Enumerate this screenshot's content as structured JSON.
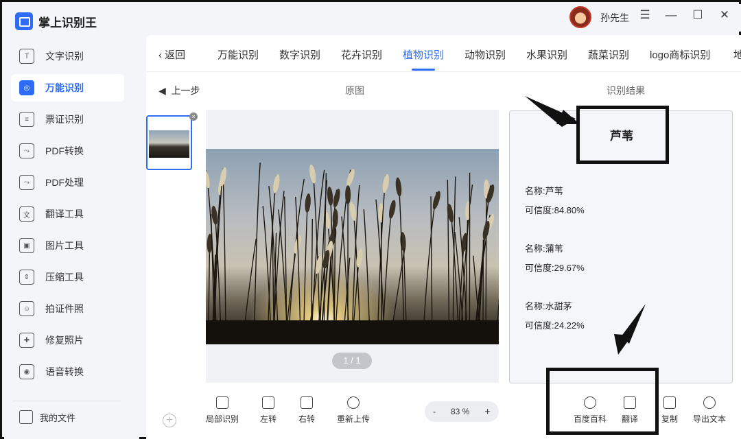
{
  "app": {
    "name": "掌上识别王"
  },
  "user": {
    "name": "孙先生"
  },
  "window_controls": [
    "☰",
    "—",
    "☐",
    "✕"
  ],
  "sidebar": {
    "items": [
      {
        "label": "文字识别",
        "icon": "text-recognition-icon",
        "glyph": "T"
      },
      {
        "label": "万能识别",
        "icon": "universal-recognition-icon",
        "glyph": "◎",
        "active": true
      },
      {
        "label": "票证识别",
        "icon": "ticket-icon",
        "glyph": "≡"
      },
      {
        "label": "PDF转换",
        "icon": "pdf-convert-icon",
        "glyph": "⤳"
      },
      {
        "label": "PDF处理",
        "icon": "pdf-process-icon",
        "glyph": "⤳"
      },
      {
        "label": "翻译工具",
        "icon": "translate-icon",
        "glyph": "文"
      },
      {
        "label": "图片工具",
        "icon": "image-icon",
        "glyph": "▣"
      },
      {
        "label": "压缩工具",
        "icon": "compress-icon",
        "glyph": "⇕"
      },
      {
        "label": "拍证件照",
        "icon": "id-photo-icon",
        "glyph": "☺"
      },
      {
        "label": "修复照片",
        "icon": "repair-photo-icon",
        "glyph": "✚"
      },
      {
        "label": "语音转换",
        "icon": "voice-icon",
        "glyph": "◉"
      }
    ],
    "my_files": "我的文件"
  },
  "tabs": {
    "back": "返回",
    "items": [
      "万能识别",
      "数字识别",
      "花卉识别",
      "植物识别",
      "动物识别",
      "水果识别",
      "蔬菜识别",
      "logo商标识别",
      "地"
    ],
    "active_index": 3
  },
  "panel": {
    "prev_step": "上一步",
    "original_title": "原图",
    "result_title": "识别结果",
    "page_indicator": "1 / 1"
  },
  "result": {
    "headline": "芦苇",
    "candidates": [
      {
        "name": "名称:芦苇",
        "confidence": "可信度:84.80%"
      },
      {
        "name": "名称:蒲苇",
        "confidence": "可信度:29.67%"
      },
      {
        "name": "名称:水甜茅",
        "confidence": "可信度:24.22%"
      }
    ]
  },
  "toolbar": {
    "left": [
      "局部识别",
      "左转",
      "右转",
      "重新上传"
    ],
    "zoom": {
      "minus": "-",
      "value": "83 %",
      "plus": "+"
    },
    "right": [
      "百度百科",
      "翻译",
      "复制",
      "导出文本"
    ]
  }
}
